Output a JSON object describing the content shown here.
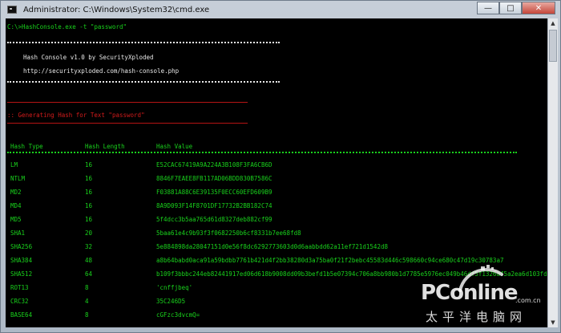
{
  "window": {
    "title": "Administrator: C:\\Windows\\System32\\cmd.exe",
    "minimize_label": "—",
    "maximize_label": "□",
    "close_label": "✕"
  },
  "console": {
    "command": "C:\\>HashConsole.exe -t \"password\"",
    "banner": {
      "line1": "Hash Console v1.0 by SecurityXploded",
      "line2": "http://securityxploded.com/hash-console.php"
    },
    "status": ":: Generating Hash for Text \"password\"",
    "headers": {
      "type": "Hash Type",
      "length": "Hash Length",
      "value": "Hash Value"
    },
    "rows": [
      {
        "type": "LM",
        "length": "16",
        "value": "E52CAC67419A9A224A3B108F3FA6CB6D"
      },
      {
        "type": "NTLM",
        "length": "16",
        "value": "8846F7EAEE8FB117AD06BDD830B7586C"
      },
      {
        "type": "MD2",
        "length": "16",
        "value": "F03881A88C6E39135F0ECC60EFD609B9"
      },
      {
        "type": "MD4",
        "length": "16",
        "value": "8A9D093F14F8701DF17732B2BB182C74"
      },
      {
        "type": "MD5",
        "length": "16",
        "value": "5f4dcc3b5aa765d61d8327deb882cf99"
      },
      {
        "type": "SHA1",
        "length": "20",
        "value": "5baa61e4c9b93f3f0682250b6cf8331b7ee68fd8"
      },
      {
        "type": "SHA256",
        "length": "32",
        "value": "5e884898da28047151d0e56f8dc6292773603d0d6aabbdd62a11ef721d1542d8"
      },
      {
        "type": "SHA384",
        "length": "48",
        "value": "a8b64babd0aca91a59bdbb7761b421d4f2bb38280d3a75ba0f21f2bebc45583d446c598660c94ce680c47d19c30783a7"
      },
      {
        "type": "SHA512",
        "length": "64",
        "value": "b109f3bbbc244eb82441917ed06d618b9008dd09b3befd1b5e07394c706a8bb980b1d7785e5976ec049b46df5f1326af5a2ea6d103fd07c95385ffab0cacbc86"
      },
      {
        "type": "ROT13",
        "length": "8",
        "value": "'cnffjbeq'"
      },
      {
        "type": "CRC32",
        "length": "4",
        "value": "35C246D5"
      },
      {
        "type": "BASE64",
        "length": "8",
        "value": "cGFzc3dvcmQ="
      }
    ]
  },
  "watermark": {
    "logo": "PConline",
    "domain": ".com.cn",
    "chinese": "太平洋电脑网"
  }
}
